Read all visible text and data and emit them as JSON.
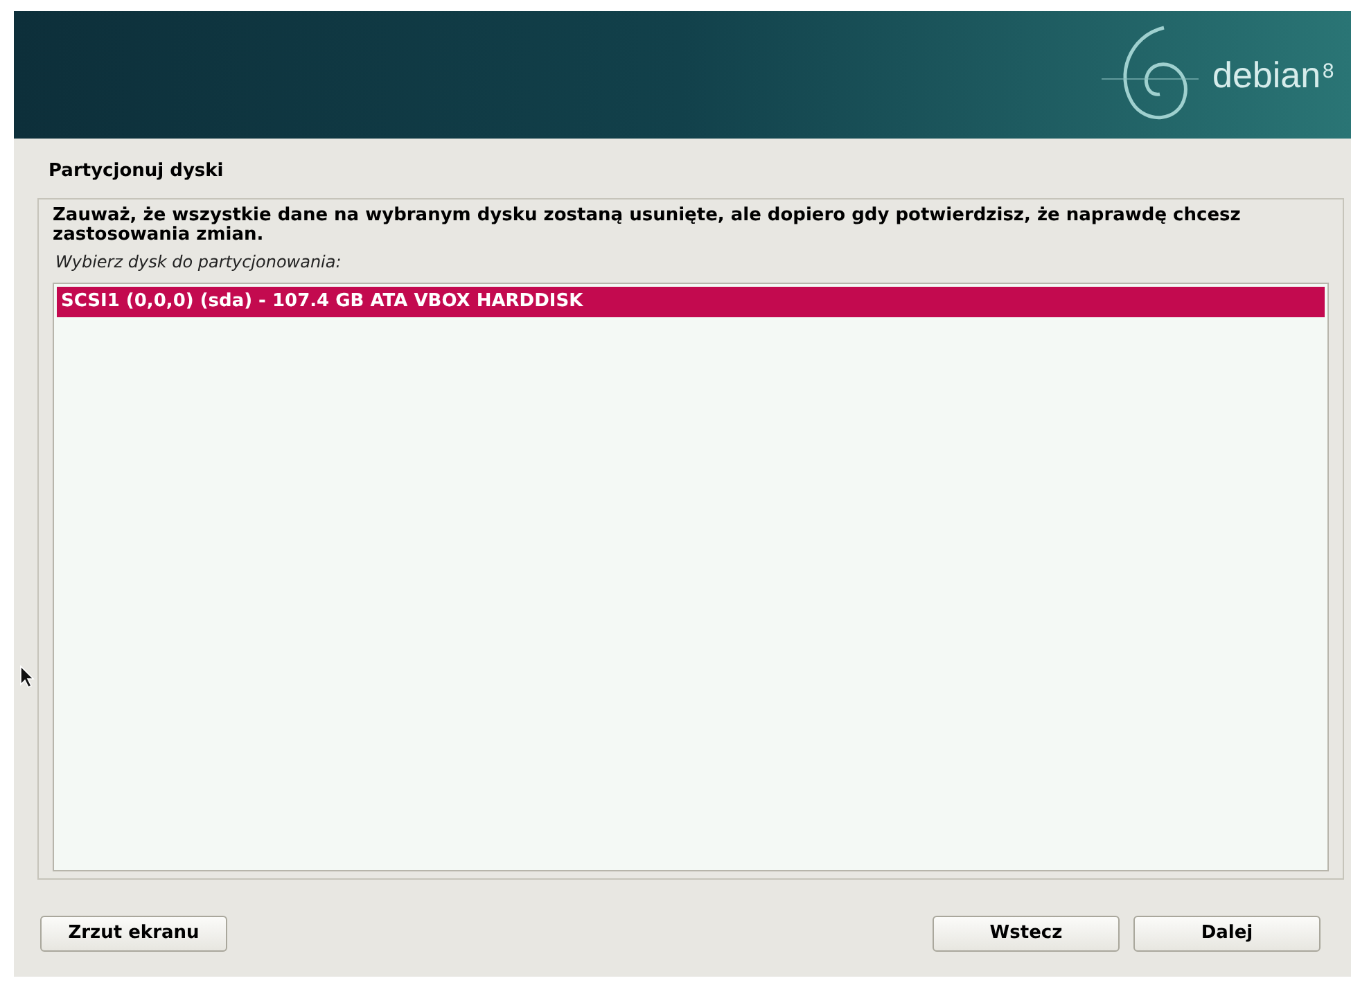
{
  "header": {
    "logo_text": "debian",
    "logo_version": "8"
  },
  "title": "Partycjonuj dyski",
  "notice": "Zauważ, że wszystkie dane na wybranym dysku zostaną usunięte, ale dopiero gdy potwierdzisz, że naprawdę chcesz zastosowania zmian.",
  "prompt": "Wybierz dysk do partycjonowania:",
  "disks": [
    {
      "label": "SCSI1 (0,0,0) (sda) - 107.4 GB ATA VBOX HARDDISK",
      "selected": true
    }
  ],
  "buttons": {
    "left": [
      "Zrzut ekranu"
    ],
    "right": [
      "Wstecz",
      "Dalej"
    ]
  }
}
